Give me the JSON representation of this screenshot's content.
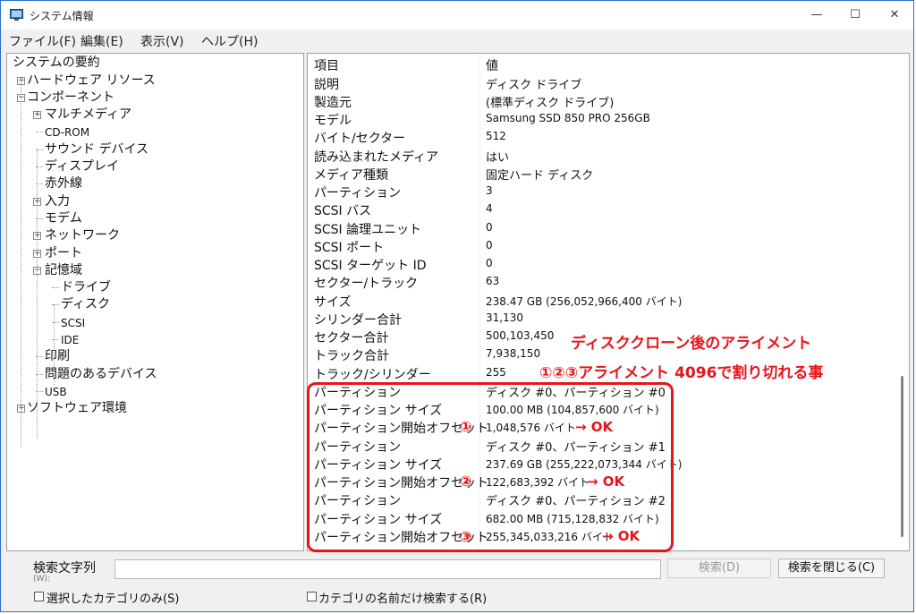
{
  "window": {
    "title": "システム情報",
    "minimize": "—",
    "maximize": "☐",
    "close": "✕"
  },
  "menu": [
    "ファイル(F)",
    "編集(E)",
    "表示(V)",
    "ヘルプ(H)"
  ],
  "tree": {
    "root": "システムの要約",
    "items": [
      {
        "label": "ハードウェア リソース",
        "level": 1,
        "expander": "+"
      },
      {
        "label": "コンポーネント",
        "level": 1,
        "expander": "−"
      },
      {
        "label": "マルチメディア",
        "level": 2,
        "expander": "+"
      },
      {
        "label": "CD-ROM",
        "level": 2,
        "small": true
      },
      {
        "label": "サウンド デバイス",
        "level": 2
      },
      {
        "label": "ディスプレイ",
        "level": 2
      },
      {
        "label": "赤外線",
        "level": 2
      },
      {
        "label": "入力",
        "level": 2,
        "expander": "+"
      },
      {
        "label": "モデム",
        "level": 2
      },
      {
        "label": "ネットワーク",
        "level": 2,
        "expander": "+"
      },
      {
        "label": "ポート",
        "level": 2,
        "expander": "+"
      },
      {
        "label": "記憶域",
        "level": 2,
        "expander": "−"
      },
      {
        "label": "ドライブ",
        "level": 3
      },
      {
        "label": "ディスク",
        "level": 3
      },
      {
        "label": "SCSI",
        "level": 3,
        "small": true
      },
      {
        "label": "IDE",
        "level": 3,
        "small": true
      },
      {
        "label": "印刷",
        "level": 2
      },
      {
        "label": "問題のあるデバイス",
        "level": 2
      },
      {
        "label": "USB",
        "level": 2,
        "small": true
      },
      {
        "label": "ソフトウェア環境",
        "level": 1,
        "expander": "+"
      }
    ]
  },
  "list": {
    "header_item": "項目",
    "header_value": "値",
    "rows": [
      {
        "item": "説明",
        "value": "ディスク ドライブ"
      },
      {
        "item": "製造元",
        "value": "(標準ディスク ドライブ)"
      },
      {
        "item": "モデル",
        "value": "Samsung SSD 850 PRO 256GB",
        "small": true
      },
      {
        "item": "バイト/セクター",
        "value": "512",
        "small": true
      },
      {
        "item": "読み込まれたメディア",
        "value": "はい"
      },
      {
        "item": "メディア種類",
        "value": "固定ハード ディスク"
      },
      {
        "item": "パーティション",
        "value": "3",
        "small": true
      },
      {
        "item": "SCSI バス",
        "value": "4",
        "small": true
      },
      {
        "item": "SCSI 論理ユニット",
        "value": "0",
        "small": true
      },
      {
        "item": "SCSI ポート",
        "value": "0",
        "small": true
      },
      {
        "item": "SCSI ターゲット ID",
        "value": "0",
        "small": true
      },
      {
        "item": "セクター/トラック",
        "value": "63",
        "small": true
      },
      {
        "item": "サイズ",
        "value": "238.47 GB (256,052,966,400 バイト)",
        "small": true
      },
      {
        "item": "シリンダー合計",
        "value": "31,130",
        "small": true
      },
      {
        "item": "セクター合計",
        "value": "500,103,450",
        "small": true
      },
      {
        "item": "トラック合計",
        "value": "7,938,150",
        "small": true
      },
      {
        "item": "トラック/シリンダー",
        "value": "255",
        "small": true
      },
      {
        "item": "パーティション",
        "value": "ディスク #0、パーティション #0"
      },
      {
        "item": "パーティション サイズ",
        "value": "100.00 MB (104,857,600 バイト)",
        "small": true
      },
      {
        "item": "パーティション開始オフセット",
        "value": "1,048,576 バイト",
        "small": true
      },
      {
        "item": "パーティション",
        "value": "ディスク #0、パーティション #1"
      },
      {
        "item": "パーティション サイズ",
        "value": "237.69 GB (255,222,073,344 バイト)",
        "small": true
      },
      {
        "item": "パーティション開始オフセット",
        "value": "122,683,392 バイト",
        "small": true
      },
      {
        "item": "パーティション",
        "value": "ディスク #0、パーティション #2"
      },
      {
        "item": "パーティション サイズ",
        "value": "682.00 MB (715,128,832 バイト)",
        "small": true
      },
      {
        "item": "パーティション開始オフセット",
        "value": "255,345,033,216 バイト",
        "small": true
      }
    ]
  },
  "annotations": {
    "line1": "ディスククローン後のアライメント",
    "line2": "①②③アライメント 4096で割り切れる事",
    "marks": [
      "①",
      "②",
      "③"
    ],
    "ok": "→ OK",
    "color": "#e8141c"
  },
  "search": {
    "label": "検索文字列",
    "cut_label": "(W):",
    "input_value": "",
    "search_button": "検索(D)",
    "close_button": "検索を閉じる(C)",
    "check_selected": "選択したカテゴリのみ(S)",
    "check_names": "カテゴリの名前だけ検索する(R)"
  }
}
